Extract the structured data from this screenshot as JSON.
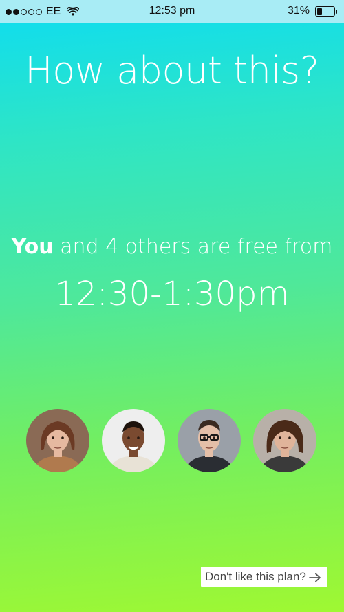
{
  "status_bar": {
    "carrier": "EE",
    "time": "12:53 pm",
    "battery_percent": "31%",
    "battery_level": 0.31,
    "signal_strength": 2,
    "signal_total": 5,
    "icons": [
      "signal-dots-icon",
      "wifi-icon",
      "battery-icon"
    ]
  },
  "main": {
    "headline": "How about this?",
    "free_prefix": "You",
    "free_suffix": " and 4 others are free from",
    "time_range": "12:30-1:30pm"
  },
  "avatars": [
    {
      "name": "avatar-woman-brown-hair",
      "bg": "#8a6a55",
      "skin": "#e6b9a0",
      "hair": "#6b3a24",
      "shirt": "#b07a4e"
    },
    {
      "name": "avatar-man-smiling",
      "bg": "#eeeeee",
      "skin": "#7a4a30",
      "hair": "#1d120c",
      "shirt": "#e8e2d6"
    },
    {
      "name": "avatar-man-glasses",
      "bg": "#9aa0a8",
      "skin": "#e4bfa8",
      "hair": "#3a2a20",
      "shirt": "#2a2d33"
    },
    {
      "name": "avatar-man-long-hair",
      "bg": "#b8b0a8",
      "skin": "#e0b49a",
      "hair": "#4a2a18",
      "shirt": "#3a3a3a"
    }
  ],
  "footer": {
    "dislike_label": "Don't like this plan?",
    "dislike_icon": "arrow-right-icon"
  },
  "colors": {
    "gradient_top": "#0ddcf2",
    "gradient_bottom": "#9ff832",
    "status_bar": "#a8ecf5",
    "text": "#ffffff"
  }
}
